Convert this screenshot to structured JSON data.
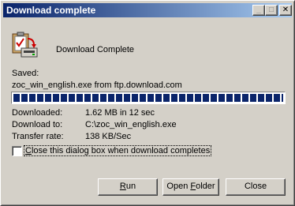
{
  "window": {
    "title": "Download complete",
    "minimize_glyph": "_",
    "maximize_glyph": "□",
    "close_glyph": "✕"
  },
  "heading": "Download Complete",
  "saved": {
    "label": "Saved:",
    "path": "zoc_win_english.exe from ftp.download.com"
  },
  "progress": {
    "fraction": 1.0
  },
  "details": [
    {
      "label": "Downloaded:",
      "value": "1.62 MB in 12 sec"
    },
    {
      "label": "Download to:",
      "value": "C:\\zoc_win_english.exe"
    },
    {
      "label": "Transfer rate:",
      "value": "138 KB/Sec"
    }
  ],
  "checkbox": {
    "label_mnemonic": "C",
    "label_rest": "lose this dialog box when download completes",
    "checked": false
  },
  "buttons": {
    "run_mnemonic": "R",
    "run_rest": "un",
    "open_pre": "Open ",
    "open_mnemonic": "F",
    "open_rest": "older",
    "close": "Close"
  }
}
